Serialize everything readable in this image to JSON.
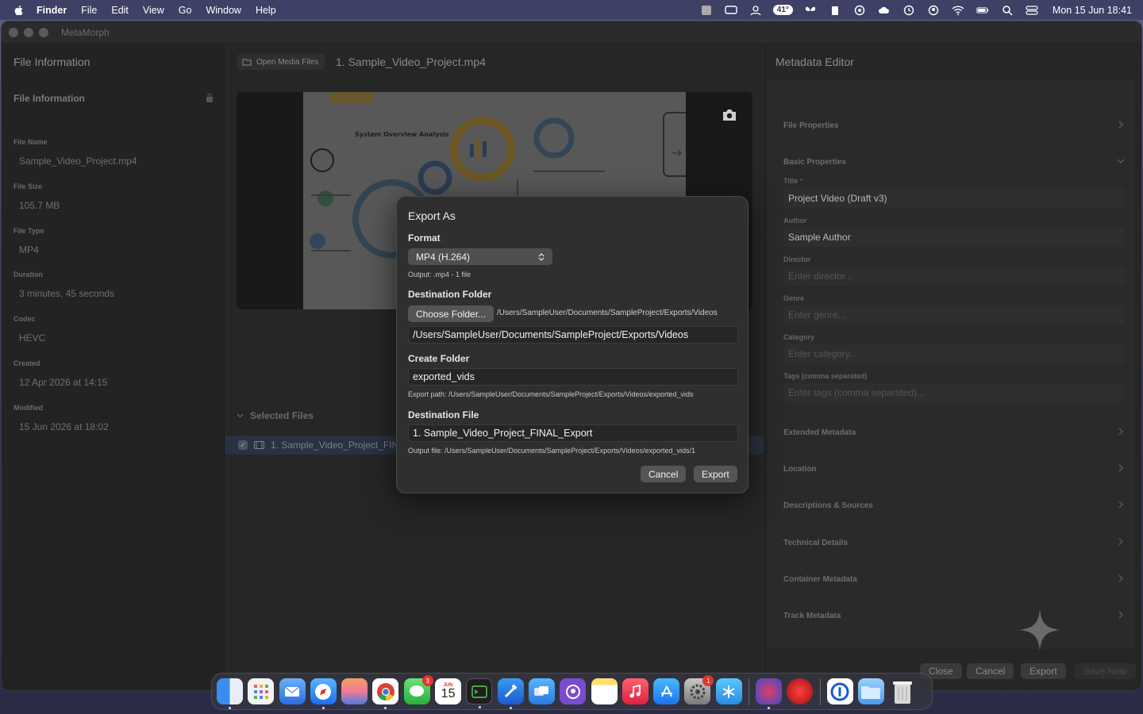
{
  "menubar": {
    "app_name": "Finder",
    "items": [
      "File",
      "Edit",
      "View",
      "Go",
      "Window",
      "Help"
    ],
    "weather": "41°",
    "clock": "Mon 15 Jun  18:41"
  },
  "window": {
    "title": "MetaMorph"
  },
  "sidebar": {
    "header": "File Information",
    "panel_title": "File Information",
    "fields": [
      {
        "label": "File Name",
        "value": "Sample_Video_Project.mp4"
      },
      {
        "label": "File Size",
        "value": "105.7 MB"
      },
      {
        "label": "File Type",
        "value": "MP4"
      },
      {
        "label": "Duration",
        "value": "3 minutes, 45 seconds"
      },
      {
        "label": "Codec",
        "value": "HEVC"
      },
      {
        "label": "Created",
        "value": "12 Apr 2026 at 14:15"
      },
      {
        "label": "Modified",
        "value": "15 Jun 2026 at 18:02"
      }
    ]
  },
  "center": {
    "open_media_label": "Open Media Files",
    "file_heading": "1. Sample_Video_Project.mp4",
    "preview_caption": "System Overview Analysis",
    "selected_header": "Selected Files",
    "selected_file": "1. Sample_Video_Project_FINAL"
  },
  "metadata": {
    "header": "Metadata Editor",
    "sections_top": [
      {
        "label": "File Properties"
      },
      {
        "label": "Basic Properties"
      }
    ],
    "fields": [
      {
        "label": "Title",
        "value": "Project Video (Draft v3)",
        "required": true
      },
      {
        "label": "Author",
        "value": "Sample Author"
      },
      {
        "label": "Director",
        "placeholder": "Enter director..."
      },
      {
        "label": "Genre",
        "placeholder": "Enter genre..."
      },
      {
        "label": "Category",
        "placeholder": "Enter category..."
      },
      {
        "label": "Tags (comma separated)",
        "placeholder": "Enter tags (comma separated)..."
      }
    ],
    "sections_bottom": [
      {
        "label": "Extended Metadata"
      },
      {
        "label": "Location"
      },
      {
        "label": "Descriptions & Sources"
      },
      {
        "label": "Technical Details"
      },
      {
        "label": "Container Metadata"
      },
      {
        "label": "Track Metadata"
      }
    ],
    "buttons": {
      "close": "Close",
      "cancel": "Cancel",
      "export": "Export",
      "save": "Save Now"
    }
  },
  "dialog": {
    "title": "Export As",
    "format_label": "Format",
    "format_value": "MP4 (H.264)",
    "format_hint": "Output: .mp4 - 1 file",
    "dest_folder_label": "Destination Folder",
    "choose_folder": "Choose Folder...",
    "dest_folder_path": "/Users/SampleUser/Documents/SampleProject/Exports/Videos",
    "dest_folder_value": "/Users/SampleUser/Documents/SampleProject/Exports/Videos",
    "create_folder_label": "Create Folder",
    "create_folder_value": "exported_vids",
    "export_path": "Export path: /Users/SampleUser/Documents/SampleProject/Exports/Videos/exported_vids",
    "dest_file_label": "Destination File",
    "dest_file_value": "1. Sample_Video_Project_FINAL_Export",
    "output_file": "Output file: /Users/SampleUser/Documents/SampleProject/Exports/Videos/exported_vids/1",
    "cancel": "Cancel",
    "export": "Export"
  },
  "dock": {
    "calendar_month": "JUN",
    "calendar_day": "15",
    "badges": {
      "messages": "3",
      "settings": "1"
    }
  }
}
